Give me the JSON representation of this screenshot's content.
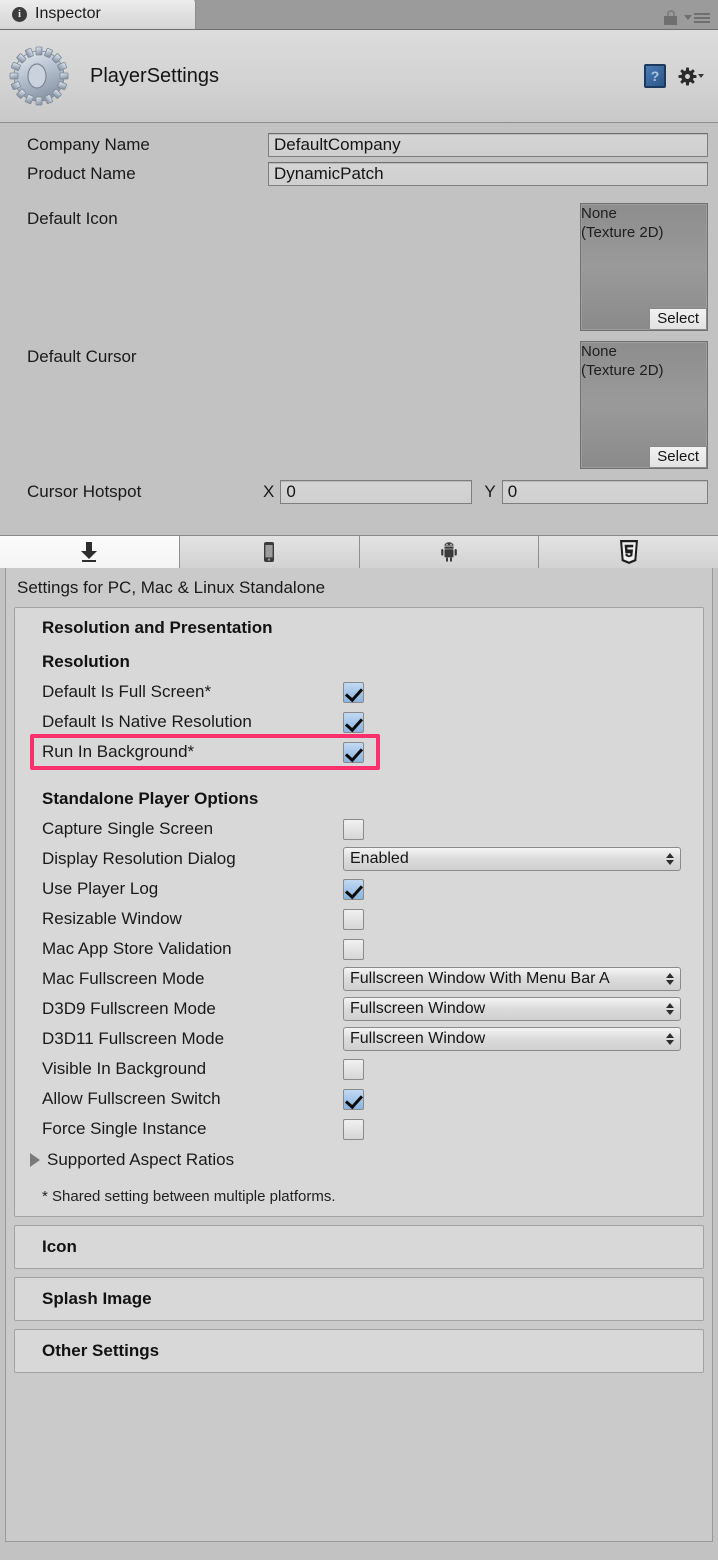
{
  "window": {
    "tab_label": "Inspector",
    "tab_icon": "info-icon",
    "lock_icon": "lock-icon",
    "menu_icon": "hamburger-menu-icon"
  },
  "object_header": {
    "title": "PlayerSettings",
    "asset_icon": "gear-asset-icon",
    "help_icon": "help-book-icon",
    "help_glyph": "?",
    "settings_icon": "gear-dropdown-icon"
  },
  "properties": {
    "company_name": {
      "label": "Company Name",
      "value": "DefaultCompany"
    },
    "product_name": {
      "label": "Product Name",
      "value": "DynamicPatch"
    },
    "default_icon": {
      "label": "Default Icon",
      "value_line1": "None",
      "value_line2": "(Texture 2D)",
      "select_label": "Select"
    },
    "default_cursor": {
      "label": "Default Cursor",
      "value_line1": "None",
      "value_line2": "(Texture 2D)",
      "select_label": "Select"
    },
    "cursor_hotspot": {
      "label": "Cursor Hotspot",
      "x_label": "X",
      "x_value": "0",
      "y_label": "Y",
      "y_value": "0"
    }
  },
  "platform_tabs": [
    {
      "name": "standalone",
      "icon": "download-arrow-icon",
      "active": true
    },
    {
      "name": "ios",
      "icon": "phone-icon",
      "active": false
    },
    {
      "name": "android",
      "icon": "android-robot-icon",
      "active": false
    },
    {
      "name": "webgl",
      "icon": "html5-shield-icon",
      "active": false
    }
  ],
  "settings": {
    "title": "Settings for PC, Mac & Linux Standalone",
    "group_title": "Resolution and Presentation",
    "resolution": {
      "subtitle": "Resolution",
      "items": [
        {
          "label": "Default Is Full Screen*",
          "type": "checkbox",
          "checked": true
        },
        {
          "label": "Default Is Native Resolution",
          "type": "checkbox",
          "checked": true
        },
        {
          "label": "Run In Background*",
          "type": "checkbox",
          "checked": true,
          "highlighted": true
        }
      ]
    },
    "standalone": {
      "subtitle": "Standalone Player Options",
      "items": [
        {
          "label": "Capture Single Screen",
          "type": "checkbox",
          "checked": false
        },
        {
          "label": "Display Resolution Dialog",
          "type": "dropdown",
          "value": "Enabled"
        },
        {
          "label": "Use Player Log",
          "type": "checkbox",
          "checked": true
        },
        {
          "label": "Resizable Window",
          "type": "checkbox",
          "checked": false
        },
        {
          "label": "Mac App Store Validation",
          "type": "checkbox",
          "checked": false
        },
        {
          "label": "Mac Fullscreen Mode",
          "type": "dropdown",
          "value": "Fullscreen Window With Menu Bar A"
        },
        {
          "label": "D3D9 Fullscreen Mode",
          "type": "dropdown",
          "value": "Fullscreen Window"
        },
        {
          "label": "D3D11 Fullscreen Mode",
          "type": "dropdown",
          "value": "Fullscreen Window"
        },
        {
          "label": "Visible In Background",
          "type": "checkbox",
          "checked": false
        },
        {
          "label": "Allow Fullscreen Switch",
          "type": "checkbox",
          "checked": true
        },
        {
          "label": "Force Single Instance",
          "type": "checkbox",
          "checked": false
        }
      ]
    },
    "foldout": {
      "label": "Supported Aspect Ratios",
      "expanded": false
    },
    "footnote": "* Shared setting between multiple platforms.",
    "collapsed_sections": [
      {
        "label": "Icon"
      },
      {
        "label": "Splash Image"
      },
      {
        "label": "Other Settings"
      }
    ]
  },
  "colors": {
    "highlight": "#fa2f6e",
    "panel_bg": "#c2c2c2",
    "group_bg": "#d8d8d8",
    "checkbox_checked": "#8ab4e0"
  }
}
